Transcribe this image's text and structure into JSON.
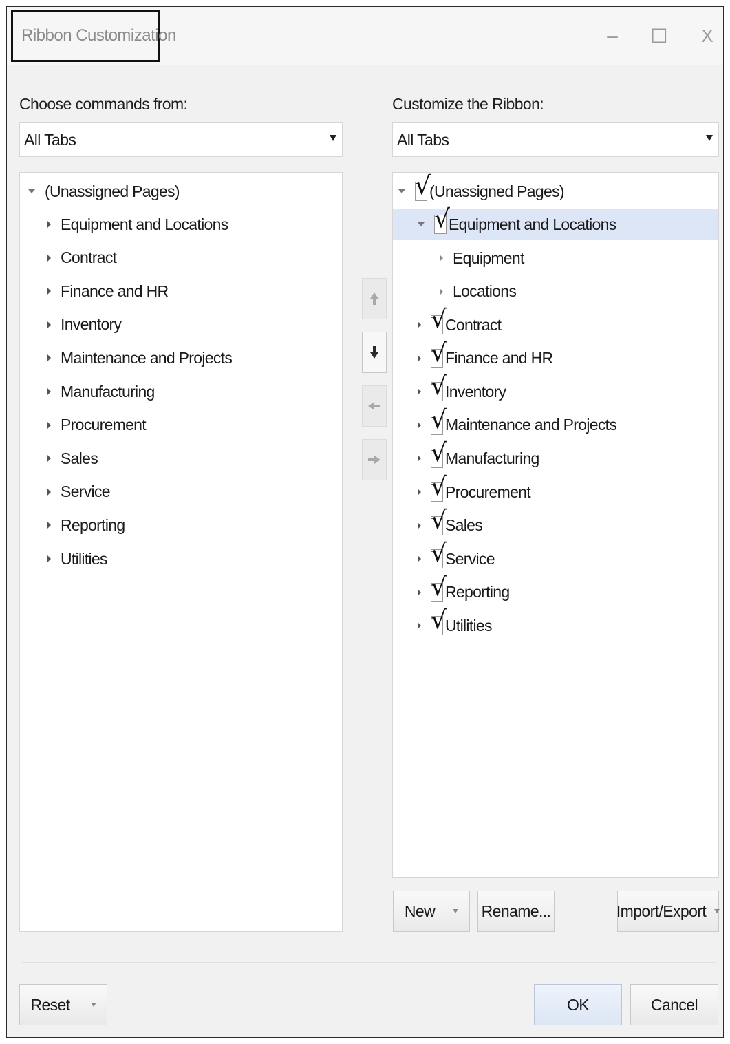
{
  "window": {
    "title": "Ribbon Customization",
    "minimize_glyph": "–",
    "maximize_glyph": "☐",
    "close_glyph": "X"
  },
  "left": {
    "label": "Choose commands from:",
    "dropdown_value": "All Tabs",
    "root": "(Unassigned Pages)",
    "items": [
      "Equipment and Locations",
      "Contract",
      "Finance and HR",
      "Inventory",
      "Maintenance and Projects",
      "Manufacturing",
      "Procurement",
      "Sales",
      "Service",
      "Reporting",
      "Utilities"
    ]
  },
  "right": {
    "label": "Customize the Ribbon:",
    "dropdown_value": "All Tabs",
    "root": "(Unassigned Pages)",
    "expanded": "Equipment and Locations",
    "children": [
      "Equipment",
      "Locations"
    ],
    "items": [
      "Contract",
      "Finance and HR",
      "Inventory",
      "Maintenance and Projects",
      "Manufacturing",
      "Procurement",
      "Sales",
      "Service",
      "Reporting",
      "Utilities"
    ],
    "checkmark": "√"
  },
  "buttons": {
    "new": "New",
    "rename": "Rename...",
    "import_export": "Import/Export",
    "reset": "Reset",
    "ok": "OK",
    "cancel": "Cancel"
  },
  "colors": {
    "accent_orange": "#e8622c",
    "selection": "#dde6f7"
  }
}
